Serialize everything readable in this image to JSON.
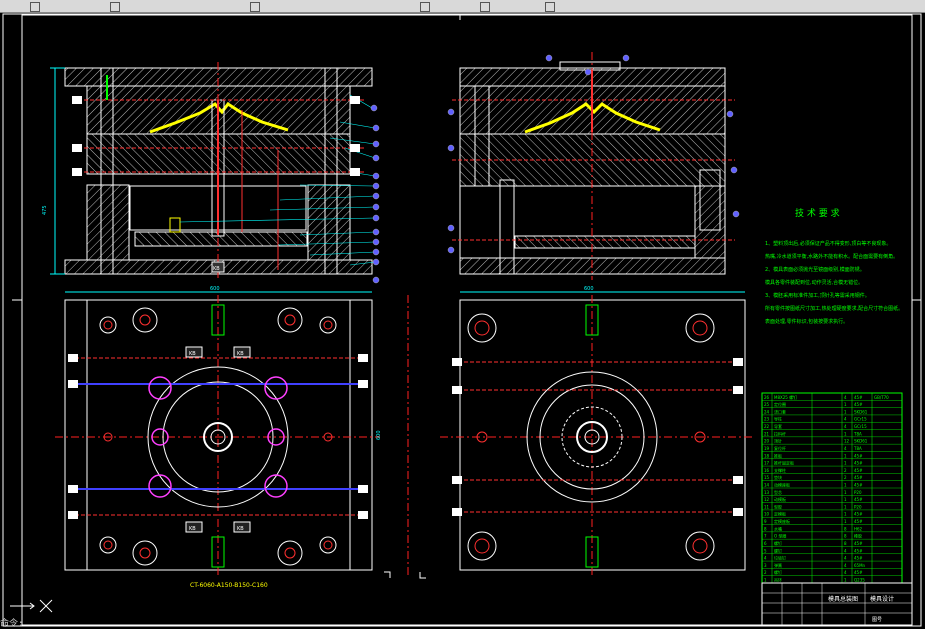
{
  "colors": {
    "background": "#000000",
    "frame": "#ffffff",
    "hatch": "#c8c8c8",
    "part_yellow": "#ffff00",
    "centerline": "#ff2020",
    "dimension": "#00ffff",
    "balloon": "#6060ff",
    "pin_red": "#ff3030",
    "pin_magenta": "#ff40ff",
    "pin_green": "#00ff00",
    "table_green": "#00ff00"
  },
  "drawing": {
    "plan_label": "CT-6060-A150-B150-C160",
    "tech_title": "技 术 要 求",
    "tech_notes": [
      "1、塑料顶出后,必须保证产品不得变形,顶白等不良现象。",
      "热嘴,冷水道须平衡,水路外不能有积水。配合面需要有倒角。",
      "2、模具表面必须抛光至镜面级别,模面防锈。",
      "模具各零件装配到位,动作灵活,合模无错位。",
      "3、模胚采用标准件加工,顶针孔等需采用钢件。",
      "所有零件按图纸尺寸加工,热处理硬度要求,配合尺寸符合图纸。",
      "表面处理,零件标识,包装按要求执行。"
    ],
    "title_block": {
      "drawing_name": "模具总装图",
      "company": "模具设计",
      "drawing_no": "图号"
    },
    "dims": {
      "plan_width_left": "600",
      "plan_width_right": "600",
      "plan_height": "600",
      "section_height": "475"
    },
    "kb_labels": [
      "KB",
      "KB",
      "KB",
      "KB",
      "KB"
    ]
  },
  "bom": {
    "columns": [
      "序号",
      "名称",
      "数量",
      "材料",
      "备注"
    ],
    "rows": [
      [
        "26",
        "M8X25 螺钉",
        "4",
        "45#",
        "GB/T70"
      ],
      [
        "25",
        "定位圈",
        "1",
        "45#",
        ""
      ],
      [
        "24",
        "浇口套",
        "1",
        "SKD61",
        ""
      ],
      [
        "23",
        "导柱",
        "4",
        "GCr15",
        ""
      ],
      [
        "22",
        "导套",
        "4",
        "GCr15",
        ""
      ],
      [
        "21",
        "拉料杆",
        "1",
        "T8A",
        ""
      ],
      [
        "20",
        "顶针",
        "12",
        "SKD61",
        ""
      ],
      [
        "19",
        "复位杆",
        "4",
        "T8A",
        ""
      ],
      [
        "18",
        "推板",
        "1",
        "45#",
        ""
      ],
      [
        "17",
        "推杆固定板",
        "1",
        "45#",
        ""
      ],
      [
        "16",
        "支撑柱",
        "2",
        "45#",
        ""
      ],
      [
        "15",
        "垫块",
        "2",
        "45#",
        ""
      ],
      [
        "14",
        "动模座板",
        "1",
        "45#",
        ""
      ],
      [
        "13",
        "型芯",
        "1",
        "P20",
        ""
      ],
      [
        "12",
        "动模板",
        "1",
        "45#",
        ""
      ],
      [
        "11",
        "型腔",
        "1",
        "P20",
        ""
      ],
      [
        "10",
        "定模板",
        "1",
        "45#",
        ""
      ],
      [
        "9",
        "定模座板",
        "1",
        "45#",
        ""
      ],
      [
        "8",
        "水嘴",
        "8",
        "H62",
        ""
      ],
      [
        "7",
        "O 型圈",
        "8",
        "橡胶",
        ""
      ],
      [
        "6",
        "螺钉",
        "8",
        "45#",
        ""
      ],
      [
        "5",
        "螺钉",
        "4",
        "45#",
        ""
      ],
      [
        "4",
        "垃圾钉",
        "4",
        "45#",
        ""
      ],
      [
        "3",
        "弹簧",
        "4",
        "65Mn",
        ""
      ],
      [
        "2",
        "螺钉",
        "4",
        "45#",
        ""
      ],
      [
        "1",
        "吊环",
        "1",
        "Q235",
        ""
      ]
    ]
  },
  "ui": {
    "command_line": "命令:"
  }
}
